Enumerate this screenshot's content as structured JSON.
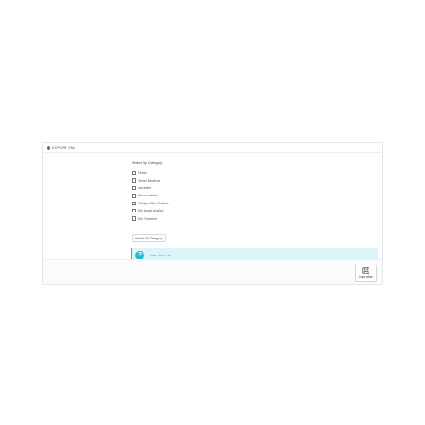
{
  "panel": {
    "heading": "EXPORT XML"
  },
  "category": {
    "title": "Select By Category",
    "items": [
      {
        "label": "Home",
        "checked": false
      },
      {
        "label": "Temel Besleme",
        "checked": false
      },
      {
        "label": "İçecekler",
        "checked": false
      },
      {
        "label": "Atıştırmalıklar",
        "checked": false
      },
      {
        "label": "Takviye Edici Gıdalar",
        "checked": false
      },
      {
        "label": "Kilo Ayağı Azaltıcı",
        "checked": false
      },
      {
        "label": "Kilo Yönetimi",
        "checked": false
      }
    ],
    "select_all_label": "Select All Category"
  },
  "info": {
    "icon": "question-icon",
    "link_label": "View Xml Link"
  },
  "footer": {
    "save_label": "Dışa aktar",
    "save_icon": "save-icon"
  },
  "colors": {
    "accent": "#25b9d7",
    "info_bg": "#dcf4f9"
  }
}
